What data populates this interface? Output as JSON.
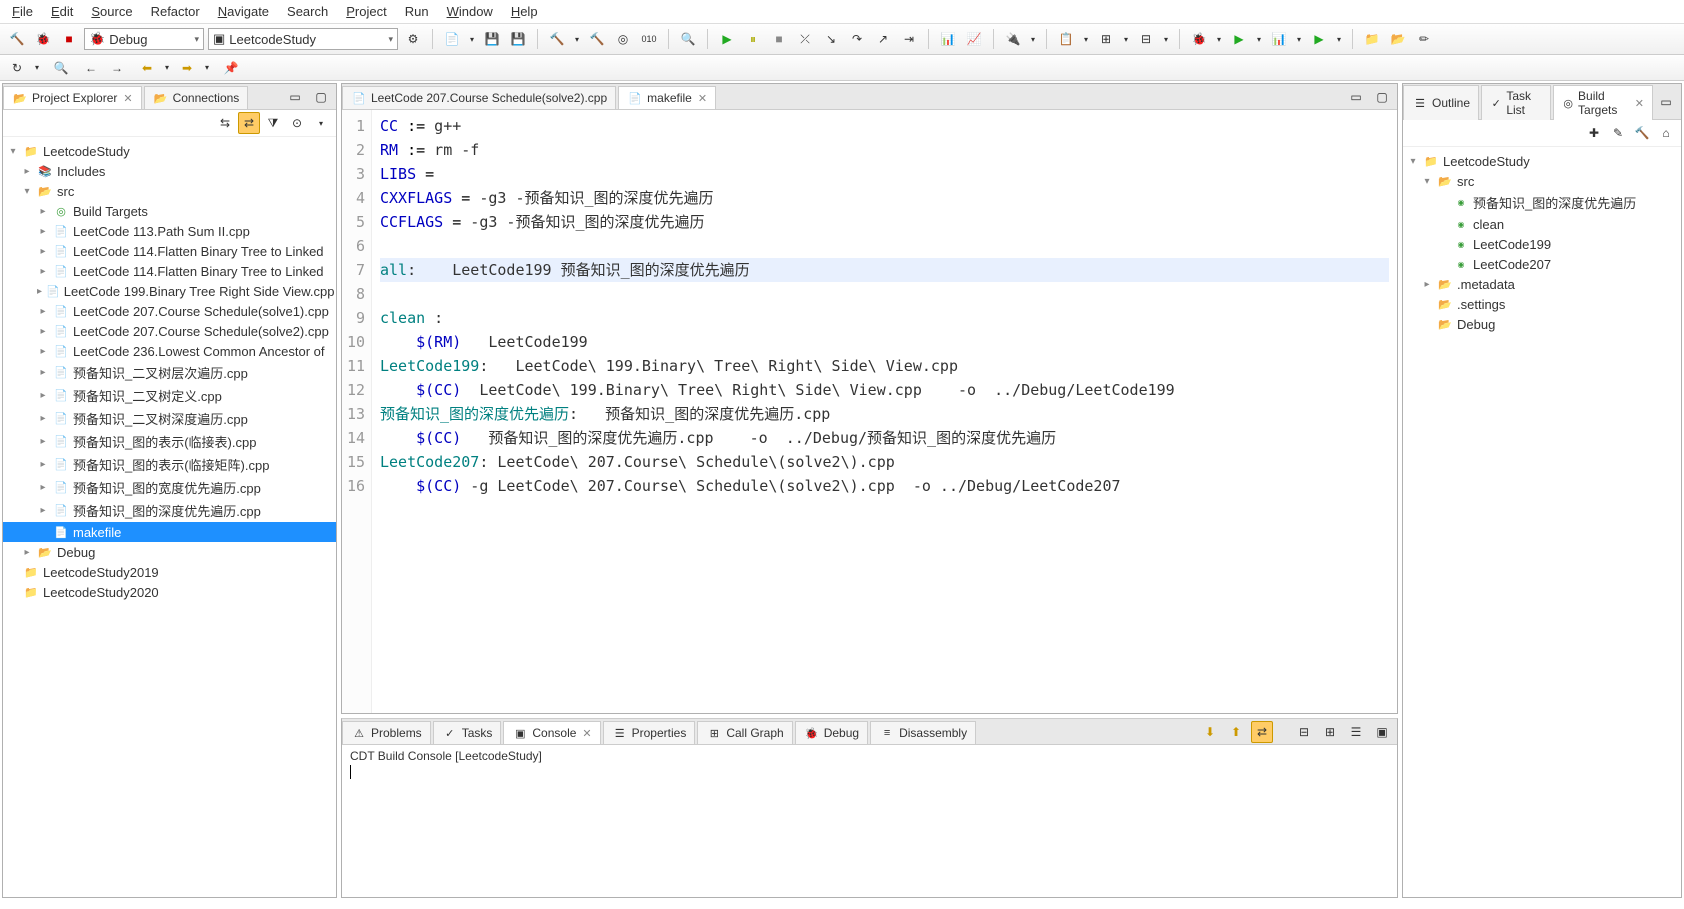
{
  "menu": [
    "File",
    "Edit",
    "Source",
    "Refactor",
    "Navigate",
    "Search",
    "Project",
    "Run",
    "Window",
    "Help"
  ],
  "menuUnderline": [
    0,
    0,
    0,
    -1,
    0,
    -1,
    0,
    -1,
    0,
    0
  ],
  "toolbar": {
    "debugConfig": "Debug",
    "launchConfig": "LeetcodeStudy"
  },
  "leftTabs": [
    {
      "label": "Project Explorer",
      "active": true
    },
    {
      "label": "Connections",
      "active": false
    }
  ],
  "projectTree": [
    {
      "d": 0,
      "tw": "▾",
      "ic": "📁",
      "cls": "icon-proj",
      "label": "LeetcodeStudy",
      "sel": false
    },
    {
      "d": 1,
      "tw": "▸",
      "ic": "📚",
      "cls": "icon-file",
      "label": "Includes",
      "sel": false
    },
    {
      "d": 1,
      "tw": "▾",
      "ic": "📂",
      "cls": "icon-folder",
      "label": "src",
      "sel": false
    },
    {
      "d": 2,
      "tw": "▸",
      "ic": "◎",
      "cls": "icon-target",
      "label": "Build Targets",
      "sel": false
    },
    {
      "d": 2,
      "tw": "▸",
      "ic": "📄",
      "cls": "icon-file",
      "label": "LeetCode 113.Path Sum II.cpp",
      "sel": false
    },
    {
      "d": 2,
      "tw": "▸",
      "ic": "📄",
      "cls": "icon-file",
      "label": "LeetCode 114.Flatten Binary Tree to Linked",
      "sel": false
    },
    {
      "d": 2,
      "tw": "▸",
      "ic": "📄",
      "cls": "icon-file",
      "label": "LeetCode 114.Flatten Binary Tree to Linked",
      "sel": false
    },
    {
      "d": 2,
      "tw": "▸",
      "ic": "📄",
      "cls": "icon-file",
      "label": "LeetCode 199.Binary Tree Right Side View.cpp",
      "sel": false
    },
    {
      "d": 2,
      "tw": "▸",
      "ic": "📄",
      "cls": "icon-file",
      "label": "LeetCode 207.Course Schedule(solve1).cpp",
      "sel": false
    },
    {
      "d": 2,
      "tw": "▸",
      "ic": "📄",
      "cls": "icon-file",
      "label": "LeetCode 207.Course Schedule(solve2).cpp",
      "sel": false
    },
    {
      "d": 2,
      "tw": "▸",
      "ic": "📄",
      "cls": "icon-file",
      "label": "LeetCode 236.Lowest Common Ancestor of",
      "sel": false
    },
    {
      "d": 2,
      "tw": "▸",
      "ic": "📄",
      "cls": "icon-file",
      "label": "预备知识_二叉树层次遍历.cpp",
      "sel": false
    },
    {
      "d": 2,
      "tw": "▸",
      "ic": "📄",
      "cls": "icon-file",
      "label": "预备知识_二叉树定义.cpp",
      "sel": false
    },
    {
      "d": 2,
      "tw": "▸",
      "ic": "📄",
      "cls": "icon-file",
      "label": "预备知识_二叉树深度遍历.cpp",
      "sel": false
    },
    {
      "d": 2,
      "tw": "▸",
      "ic": "📄",
      "cls": "icon-file",
      "label": "预备知识_图的表示(临接表).cpp",
      "sel": false
    },
    {
      "d": 2,
      "tw": "▸",
      "ic": "📄",
      "cls": "icon-file",
      "label": "预备知识_图的表示(临接矩阵).cpp",
      "sel": false
    },
    {
      "d": 2,
      "tw": "▸",
      "ic": "📄",
      "cls": "icon-file",
      "label": "预备知识_图的宽度优先遍历.cpp",
      "sel": false
    },
    {
      "d": 2,
      "tw": "▸",
      "ic": "📄",
      "cls": "icon-file",
      "label": "预备知识_图的深度优先遍历.cpp",
      "sel": false
    },
    {
      "d": 2,
      "tw": "",
      "ic": "📄",
      "cls": "icon-file",
      "label": "makefile",
      "sel": true
    },
    {
      "d": 1,
      "tw": "▸",
      "ic": "📂",
      "cls": "icon-folder",
      "label": "Debug",
      "sel": false
    },
    {
      "d": 0,
      "tw": "",
      "ic": "📁",
      "cls": "icon-proj",
      "label": "LeetcodeStudy2019",
      "sel": false
    },
    {
      "d": 0,
      "tw": "",
      "ic": "📁",
      "cls": "icon-proj",
      "label": "LeetcodeStudy2020",
      "sel": false
    }
  ],
  "editorTabs": [
    {
      "label": "LeetCode 207.Course Schedule(solve2).cpp",
      "active": false,
      "icon": "📄"
    },
    {
      "label": "makefile",
      "active": true,
      "icon": "📄"
    }
  ],
  "code": [
    {
      "n": 1,
      "html": "<span class='var'>CC</span> <span class='op'>:=</span> g++"
    },
    {
      "n": 2,
      "html": "<span class='var'>RM</span> <span class='op'>:=</span> rm -f"
    },
    {
      "n": 3,
      "html": "<span class='var'>LIBS</span> <span class='op'>=</span>"
    },
    {
      "n": 4,
      "html": "<span class='var'>CXXFLAGS</span> <span class='op'>=</span> -g3 -预备知识_图的深度优先遍历"
    },
    {
      "n": 5,
      "html": "<span class='var'>CCFLAGS</span> <span class='op'>=</span> -g3 -预备知识_图的深度优先遍历"
    },
    {
      "n": 6,
      "html": ""
    },
    {
      "n": 7,
      "hl": true,
      "html": "<span class='fn'>all</span>:    LeetCode199 预备知识_图的深度优先遍历"
    },
    {
      "n": 8,
      "html": ""
    },
    {
      "n": 9,
      "html": "<span class='fn'>clean</span> :"
    },
    {
      "n": 10,
      "html": "    <span class='var'>$(RM)</span>   LeetCode199"
    },
    {
      "n": 11,
      "html": "<span class='fn'>LeetCode199</span>:   LeetCode\\ 199.Binary\\ Tree\\ Right\\ Side\\ View.cpp"
    },
    {
      "n": 12,
      "html": "    <span class='var'>$(CC)</span>  LeetCode\\ 199.Binary\\ Tree\\ Right\\ Side\\ View.cpp    -o  ../Debug/LeetCode199"
    },
    {
      "n": 13,
      "html": "<span class='fn'>预备知识_图的深度优先遍历</span>:   预备知识_图的深度优先遍历.cpp"
    },
    {
      "n": 14,
      "html": "    <span class='var'>$(CC)</span>   预备知识_图的深度优先遍历.cpp    -o  ../Debug/预备知识_图的深度优先遍历"
    },
    {
      "n": 15,
      "html": "<span class='fn'>LeetCode207</span>: LeetCode\\ 207.Course\\ Schedule\\(solve2\\).cpp"
    },
    {
      "n": 16,
      "html": "    <span class='var'>$(CC)</span> -g LeetCode\\ 207.Course\\ Schedule\\(solve2\\).cpp  -o ../Debug/LeetCode207"
    }
  ],
  "bottomTabs": [
    {
      "label": "Problems",
      "icon": "⚠"
    },
    {
      "label": "Tasks",
      "icon": "✓"
    },
    {
      "label": "Console",
      "icon": "▣",
      "active": true
    },
    {
      "label": "Properties",
      "icon": "☰"
    },
    {
      "label": "Call Graph",
      "icon": "⊞"
    },
    {
      "label": "Debug",
      "icon": "🐞"
    },
    {
      "label": "Disassembly",
      "icon": "≡"
    }
  ],
  "consoleTitle": "CDT Build Console [LeetcodeStudy]",
  "rightTabs": [
    {
      "label": "Outline",
      "icon": "☰"
    },
    {
      "label": "Task List",
      "icon": "✓"
    },
    {
      "label": "Build Targets",
      "icon": "◎",
      "active": true
    }
  ],
  "buildTargets": [
    {
      "d": 0,
      "tw": "▾",
      "ic": "📁",
      "label": "LeetcodeStudy"
    },
    {
      "d": 1,
      "tw": "▾",
      "ic": "📂",
      "label": "src"
    },
    {
      "d": 2,
      "tw": "",
      "ic": "◉",
      "cls": "outline-icon",
      "label": "预备知识_图的深度优先遍历"
    },
    {
      "d": 2,
      "tw": "",
      "ic": "◉",
      "cls": "outline-icon",
      "label": "clean"
    },
    {
      "d": 2,
      "tw": "",
      "ic": "◉",
      "cls": "outline-icon",
      "label": "LeetCode199"
    },
    {
      "d": 2,
      "tw": "",
      "ic": "◉",
      "cls": "outline-icon",
      "label": "LeetCode207"
    },
    {
      "d": 1,
      "tw": "▸",
      "ic": "📂",
      "label": ".metadata"
    },
    {
      "d": 1,
      "tw": "",
      "ic": "📂",
      "label": ".settings"
    },
    {
      "d": 1,
      "tw": "",
      "ic": "📂",
      "label": "Debug"
    }
  ]
}
